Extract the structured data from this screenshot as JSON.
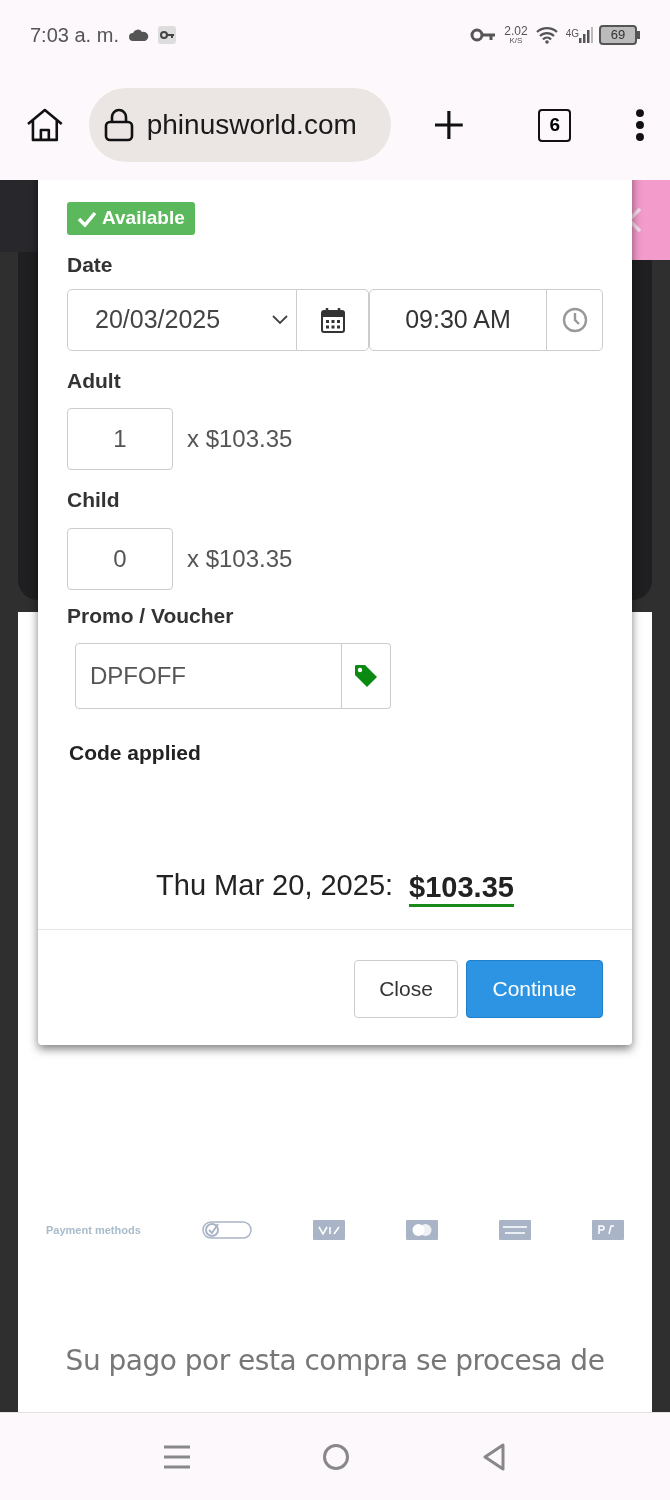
{
  "status_bar": {
    "time": "7:03 a. m.",
    "net_speed": "2.02",
    "net_speed_unit": "K/S",
    "network": "4G",
    "battery": "69"
  },
  "browser": {
    "url": "phinusworld.com",
    "tab_count": "6"
  },
  "modal": {
    "badge": "Available",
    "date_label": "Date",
    "date": "20/03/2025",
    "time": "09:30 AM",
    "quantities": [
      {
        "label": "Adult",
        "value": "1",
        "price": "x $103.35"
      },
      {
        "label": "Child",
        "value": "0",
        "price": "x $103.35"
      }
    ],
    "promo_label": "Promo / Voucher",
    "promo_value": "DPFOFF",
    "promo_status": "Code applied",
    "total_date": "Thu Mar 20, 2025:",
    "total": "$103.35",
    "buttons": [
      {
        "label": "Close",
        "kind": "secondary"
      },
      {
        "label": "Continue",
        "kind": "primary"
      }
    ]
  },
  "footer": {
    "payment_label": "Payment methods",
    "secure_text": "Su pago por esta compra se procesa de"
  }
}
